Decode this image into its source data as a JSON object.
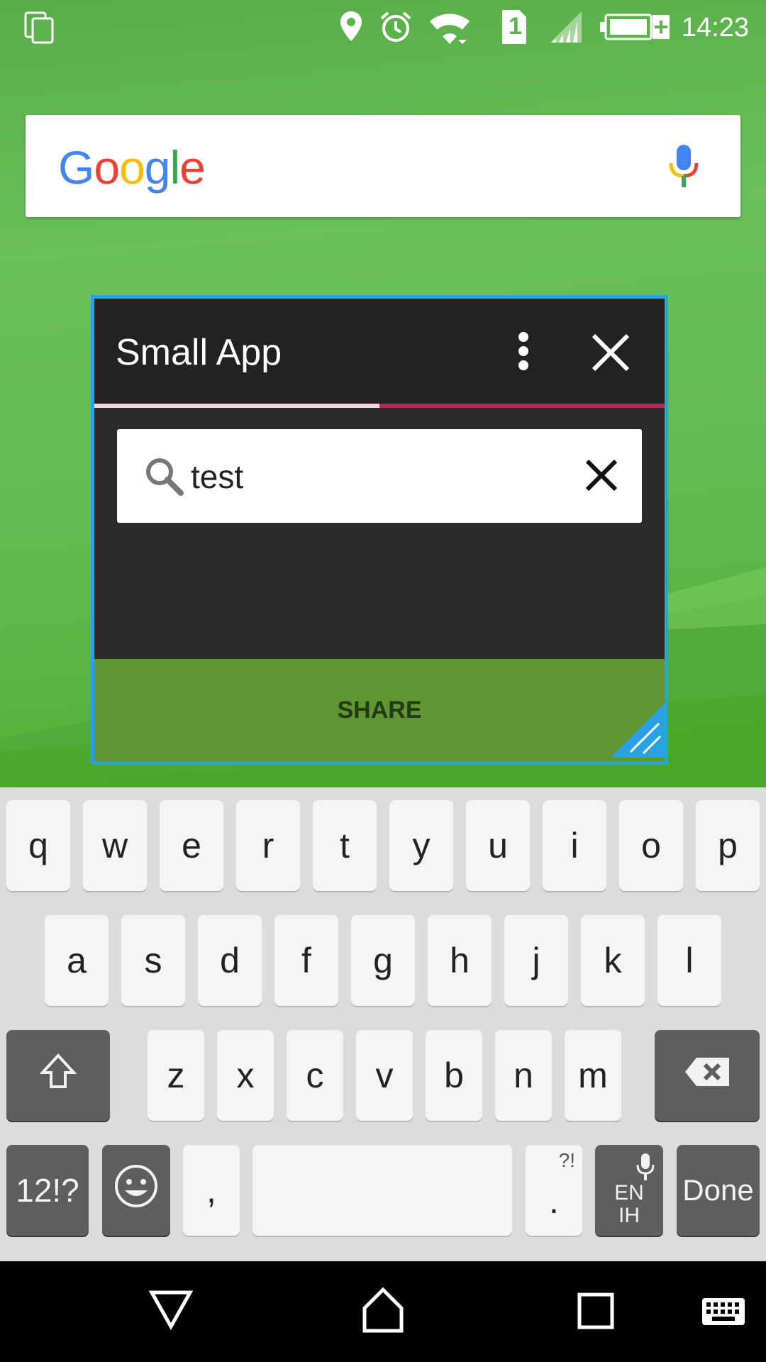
{
  "status_bar": {
    "time": "14:23",
    "sim_slot": "1",
    "icons": [
      "screenshot-icon",
      "location-icon",
      "alarm-icon",
      "wifi-icon",
      "sim-icon",
      "signal-icon",
      "battery-icon"
    ]
  },
  "google_widget": {
    "logo_letters": [
      "G",
      "o",
      "o",
      "g",
      "l",
      "e"
    ],
    "logo_colors": [
      "#4285f4",
      "#ea4335",
      "#fbbc05",
      "#4285f4",
      "#34a853",
      "#ea4335"
    ]
  },
  "small_app": {
    "title": "Small App",
    "progress_fraction": 0.5,
    "search_value": "test",
    "share_label": "SHARE",
    "accent_color": "#29a2e3"
  },
  "keyboard": {
    "row1": [
      "q",
      "w",
      "e",
      "r",
      "t",
      "y",
      "u",
      "i",
      "o",
      "p"
    ],
    "row2": [
      "a",
      "s",
      "d",
      "f",
      "g",
      "h",
      "j",
      "k",
      "l"
    ],
    "row3": [
      "z",
      "x",
      "c",
      "v",
      "b",
      "n",
      "m"
    ],
    "symbols_label": "12!?",
    "comma_label": ",",
    "period_label": ".",
    "period_hint": "?!",
    "language_label_top": "EN",
    "language_label_bottom": "IH",
    "done_label": "Done"
  },
  "nav_bar": {
    "buttons": [
      "back-icon",
      "home-icon",
      "recents-icon",
      "keyboard-icon"
    ]
  }
}
